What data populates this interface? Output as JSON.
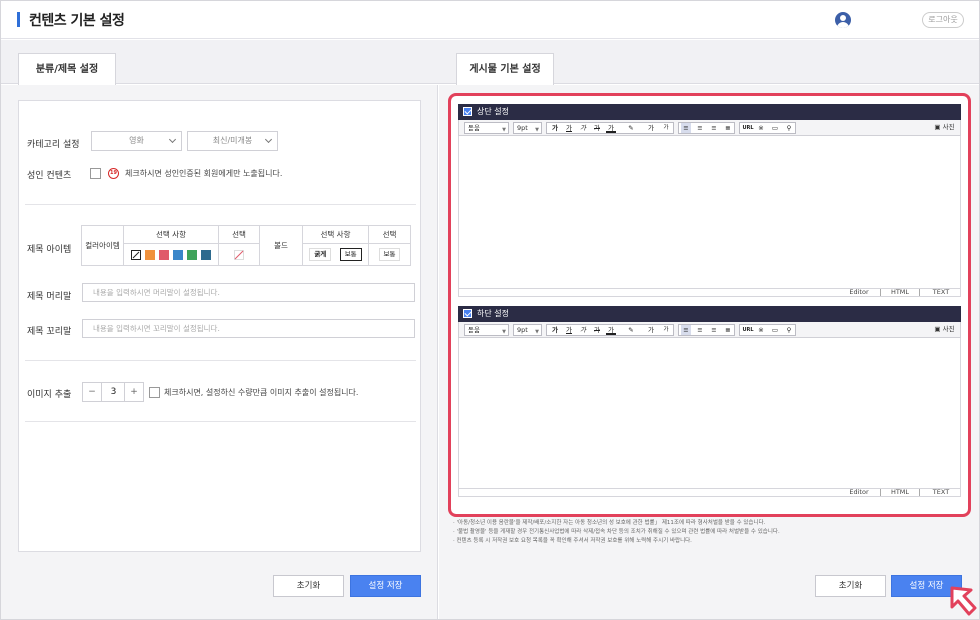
{
  "header": {
    "title": "컨텐츠 기본 설정",
    "logout_label": "로그아웃"
  },
  "tabs": {
    "left": "분류/제목 설정",
    "right": "게시물 기본 설정"
  },
  "left_form": {
    "category_label": "카테고리 설정",
    "category_select_1": "영화",
    "category_select_2": "최신/미개봉",
    "adult_label": "성인 컨텐츠",
    "adult_badge": "19",
    "adult_hint": "체크하시면 성인인증된 회원에게만 노출됩니다.",
    "title_item_label": "제목 아이템",
    "color_item_label": "컬러아이템",
    "select_option_header": "선택 사항",
    "select_header": "선택",
    "bold_label": "볼드",
    "bold_option_bold": "굵게",
    "bold_option_normal": "보통",
    "bold_selected": "보통",
    "swatch_colors": [
      "#ffffff",
      "#f0913c",
      "#e05a6a",
      "#3a86c9",
      "#3fa35a",
      "#2d6a8e"
    ],
    "title_prefix_label": "제목 머리말",
    "title_prefix_placeholder": "내용을 입력하시면 머리말이 설정됩니다.",
    "title_suffix_label": "제목 꼬리말",
    "title_suffix_placeholder": "내용을 입력하시면 꼬리말이 설정됩니다.",
    "image_extract_label": "이미지 추출",
    "image_extract_minus": "−",
    "image_extract_value": "3",
    "image_extract_plus": "+",
    "image_extract_hint": "체크하시면, 설정하신 수량만큼 이미지 추출이 설정됩니다."
  },
  "left_buttons": {
    "reset": "초기화",
    "save": "설정 저장"
  },
  "right_buttons": {
    "reset": "초기화",
    "save": "설정 저장"
  },
  "editor_top": {
    "label": "상단 설정"
  },
  "editor_bottom": {
    "label": "하단 설정"
  },
  "toolbar": {
    "font": "돋움",
    "size": "9pt",
    "bold": "가",
    "underline": "가",
    "italic": "가",
    "strike": "가",
    "color": "가",
    "size_up": "가",
    "size_down": "가",
    "url": "URL",
    "photo": "사진"
  },
  "editor_modes": {
    "editor": "Editor",
    "html": "HTML",
    "text": "TEXT"
  },
  "notes": [
    "· '아동/청소년 이용 음란물'을 제작/배포/소지한 자는 아동 청소년의 성 보호에 관한 법률」 제11조에 따라 형사처벌을 받을 수 있습니다.",
    "· '불법 촬영물' 등을 게재할 경우 전기통신사업법에 따라 삭제/접속 차단 등의 조치가 취해질 수 있으며 관련 법률에 따라 처벌받을 수 있습니다.",
    "· 컨텐츠 등록 시 저작권 보호 요청 목록을 꼭 확인해 주셔서 저작권 보호를 위해 노력해 주시기 바랍니다."
  ],
  "colors": {
    "accent": "#2f6fd8",
    "primary_button": "#4a82f0",
    "highlight": "#e2415b",
    "editor_header": "#2b2c45"
  }
}
